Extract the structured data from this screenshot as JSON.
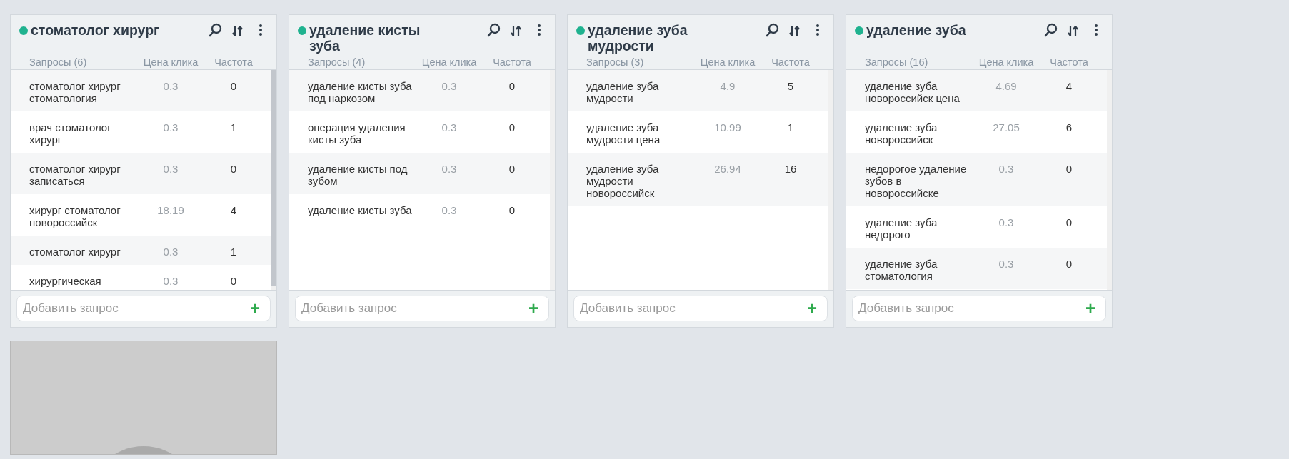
{
  "groups": [
    {
      "title": "стоматолог хирург",
      "columns": [
        "Запросы (6)",
        "Цена клика",
        "Частота"
      ],
      "rows": [
        {
          "query": "стоматолог хирург стоматология",
          "price": "0.3",
          "frequency": "0"
        },
        {
          "query": "врач стоматолог хирург",
          "price": "0.3",
          "frequency": "1"
        },
        {
          "query": "стоматолог хирург записаться",
          "price": "0.3",
          "frequency": "0"
        },
        {
          "query": "хирург стоматолог новороссийск",
          "price": "18.19",
          "frequency": "4"
        },
        {
          "query": "стоматолог хирург",
          "price": "0.3",
          "frequency": "1"
        },
        {
          "query": "хирургическая",
          "price": "0.3",
          "frequency": "0"
        }
      ],
      "add_field": {
        "placeholder": "Добавить запрос",
        "button": "+"
      }
    },
    {
      "title": "удаление кисты зуба",
      "columns": [
        "Запросы (4)",
        "Цена клика",
        "Частота"
      ],
      "rows": [
        {
          "query": "удаление кисты зуба под наркозом",
          "price": "0.3",
          "frequency": "0"
        },
        {
          "query": "операция удаления кисты зуба",
          "price": "0.3",
          "frequency": "0"
        },
        {
          "query": "удаление кисты под зубом",
          "price": "0.3",
          "frequency": "0"
        },
        {
          "query": "удаление кисты зуба",
          "price": "0.3",
          "frequency": "0"
        }
      ],
      "add_field": {
        "placeholder": "Добавить запрос",
        "button": "+"
      }
    },
    {
      "title": "удаление зуба мудрости",
      "columns": [
        "Запросы (3)",
        "Цена клика",
        "Частота"
      ],
      "rows": [
        {
          "query": "удаление зуба мудрости",
          "price": "4.9",
          "frequency": "5"
        },
        {
          "query": "удаление зуба мудрости цена",
          "price": "10.99",
          "frequency": "1"
        },
        {
          "query": "удаление зуба мудрости новороссийск",
          "price": "26.94",
          "frequency": "16"
        }
      ],
      "add_field": {
        "placeholder": "Добавить запрос",
        "button": "+"
      }
    },
    {
      "title": "удаление зуба",
      "columns": [
        "Запросы (16)",
        "Цена клика",
        "Частота"
      ],
      "rows": [
        {
          "query": "удаление зуба новороссийск цена",
          "price": "4.69",
          "frequency": "4"
        },
        {
          "query": "удаление зуба новороссийск",
          "price": "27.05",
          "frequency": "6"
        },
        {
          "query": "недорогое удаление зубов в новороссийске",
          "price": "0.3",
          "frequency": "0"
        },
        {
          "query": "удаление зуба недорого",
          "price": "0.3",
          "frequency": "0"
        },
        {
          "query": "удаление зуба стоматология",
          "price": "0.3",
          "frequency": "0"
        }
      ],
      "add_field": {
        "placeholder": "Добавить запрос",
        "button": "+"
      }
    }
  ]
}
